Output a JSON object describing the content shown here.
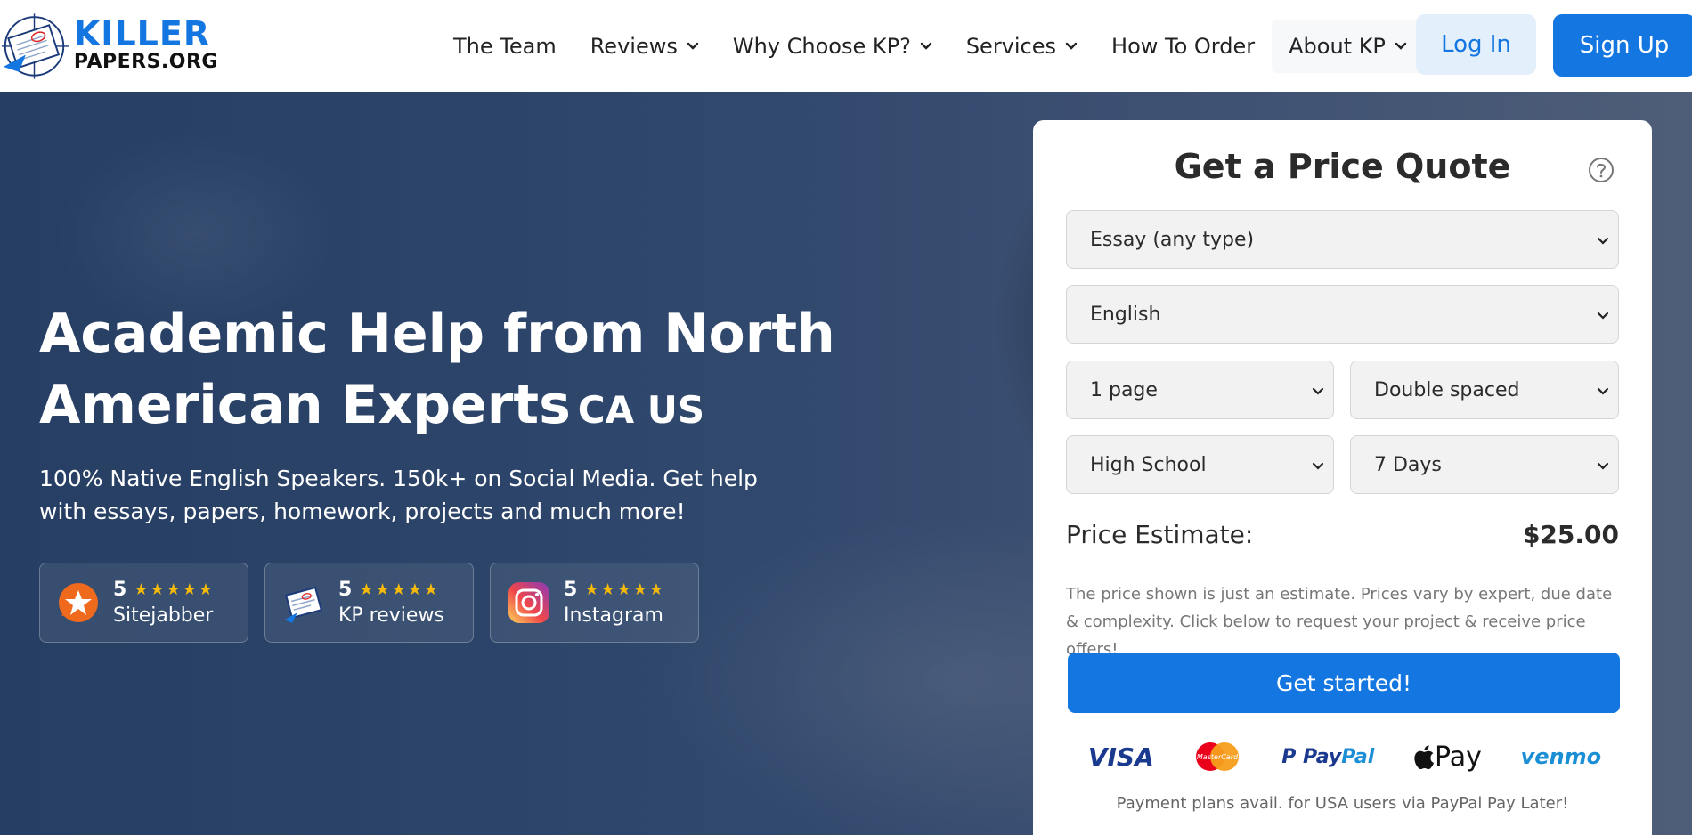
{
  "brand": {
    "line1": "KILLER",
    "line2": "PAPERS.ORG"
  },
  "nav": {
    "items": [
      {
        "label": "The Team",
        "dropdown": false
      },
      {
        "label": "Reviews",
        "dropdown": true
      },
      {
        "label": "Why Choose KP?",
        "dropdown": true
      },
      {
        "label": "Services",
        "dropdown": true
      },
      {
        "label": "How To Order",
        "dropdown": false
      },
      {
        "label": "About KP",
        "dropdown": true
      }
    ],
    "login_label": "Log In",
    "signup_label": "Sign Up"
  },
  "hero": {
    "title_line1": "Academic Help from North",
    "title_line2": "American Experts",
    "title_flags": "CA US",
    "subtitle": "100% Native English Speakers. 150k+ on Social Media. Get help with essays, papers, homework, projects and much more!",
    "badges": [
      {
        "rating": "5",
        "stars": "★★★★★",
        "name": "Sitejabber",
        "icon": "sitejabber-icon"
      },
      {
        "rating": "5",
        "stars": "★★★★★",
        "name": "KP reviews",
        "icon": "kp-reviews-icon"
      },
      {
        "rating": "5",
        "stars": "★★★★★",
        "name": "Instagram",
        "icon": "instagram-icon"
      }
    ]
  },
  "quote": {
    "title": "Get a Price Quote",
    "paper_type": "Essay (any type)",
    "subject": "English",
    "pages": "1 page",
    "spacing": "Double spaced",
    "level": "High School",
    "deadline": "7 Days",
    "price_label": "Price Estimate:",
    "price_value": "$25.00",
    "note": "The price shown is just an estimate. Prices vary by expert, due date & complexity. Click below to request your project & receive price offers!",
    "cta": "Get started!",
    "payment": {
      "visa": "VISA",
      "mastercard": "MasterCard",
      "paypal_a": "Pay",
      "paypal_b": "Pal",
      "applepay": "Pay",
      "venmo": "venmo"
    },
    "footnote": "Payment plans avail. for USA users via PayPal Pay Later!"
  },
  "colors": {
    "accent": "#1476e0",
    "login_bg": "#e3f0fc",
    "star": "#f5b90a"
  }
}
